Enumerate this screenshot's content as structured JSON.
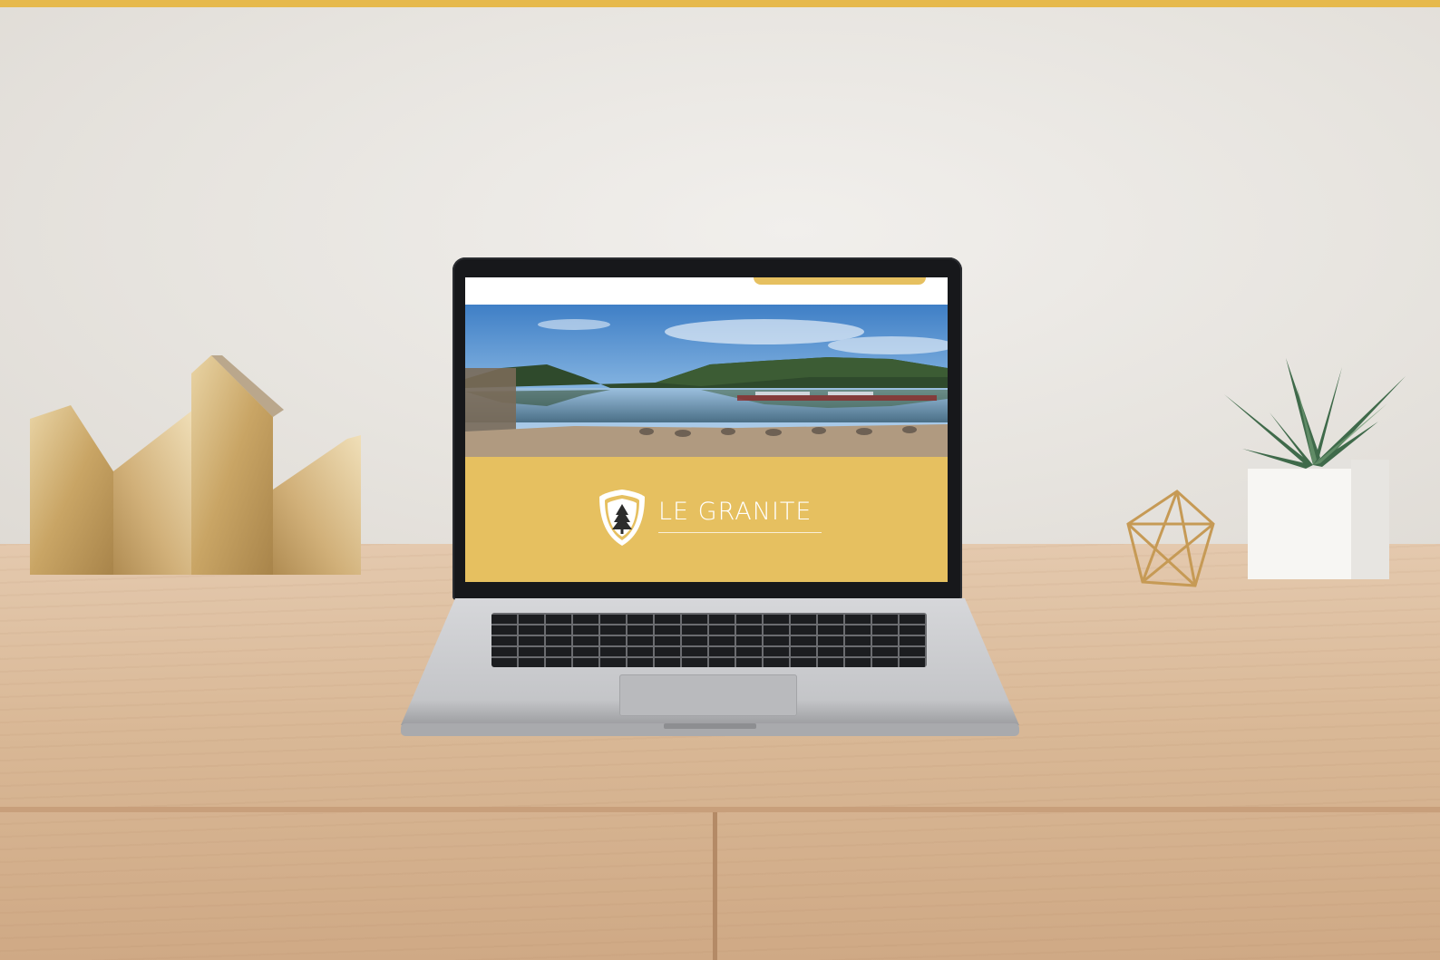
{
  "colors": {
    "accent": "#e6b94c",
    "screen_brand_yellow": "#e6c060",
    "wall": "#e9e6e1",
    "desk_wood": "#d9b896",
    "laptop_bezel": "#17181b",
    "laptop_silver": "#c9cacd"
  },
  "website": {
    "brand_name": "LE GRANITE",
    "logo_icon": "pine-tree-shield-icon",
    "hero_image": "lake-mountain-panorama"
  },
  "scene_objects": [
    "brass-mountain-vase",
    "laptop",
    "geometric-brass-ornament",
    "succulent-plant-pot"
  ]
}
